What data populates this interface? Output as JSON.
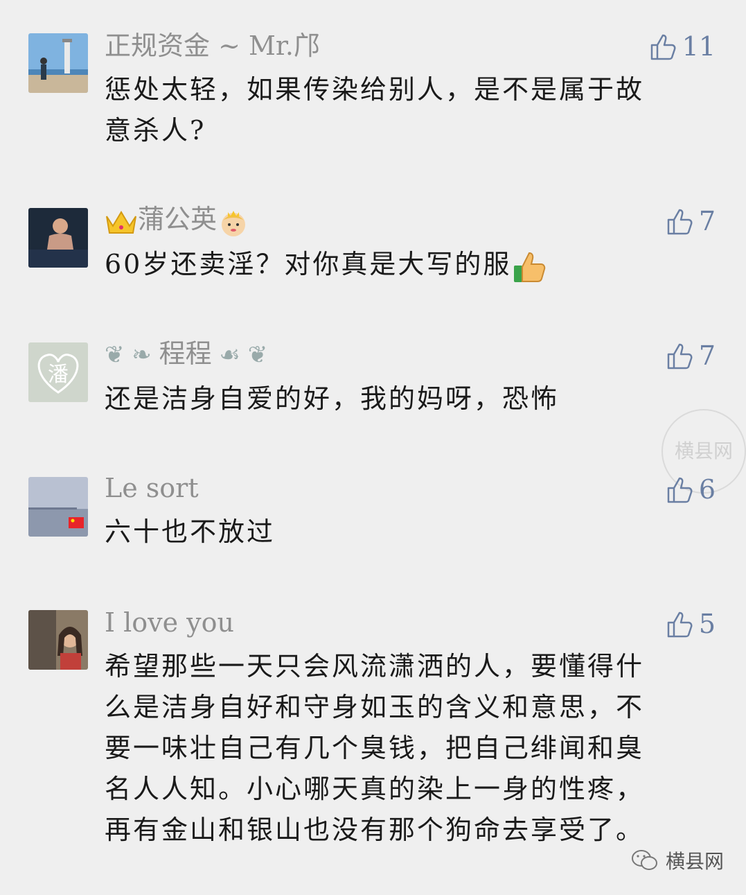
{
  "comments": [
    {
      "name": "正规资金 ~ Mr.邝",
      "likes": "11",
      "lines": [
        "惩处太轻，如果传染给别人，是不是属于故",
        "意杀人?"
      ]
    },
    {
      "name": "蒲公英",
      "likes": "7",
      "lines": [
        "60岁还卖淫？对你真是大写的服"
      ]
    },
    {
      "name": "程程",
      "likes": "7",
      "lines": [
        "还是洁身自爱的好，我的妈呀，恐怖"
      ]
    },
    {
      "name": "Le sort",
      "likes": "6",
      "lines": [
        "六十也不放过"
      ]
    },
    {
      "name": "I love you",
      "likes": "5",
      "lines": [
        "希望那些一天只会风流潇洒的人，要懂得什",
        "么是洁身自好和守身如玉的含义和意思，不",
        "要一味壮自己有几个臭钱，把自己绯闻和臭",
        "名人人知。小心哪天真的染上一身的性疼，",
        "再有金山和银山也没有那个狗命去享受了。"
      ]
    }
  ],
  "stamp_text": "横县网",
  "watermark": {
    "label": "横县网",
    "icon": "wechat-icon"
  },
  "colors": {
    "background": "#efefef",
    "name": "#8f8f8f",
    "like": "#6a7fa3",
    "text": "#1a1a1a"
  }
}
